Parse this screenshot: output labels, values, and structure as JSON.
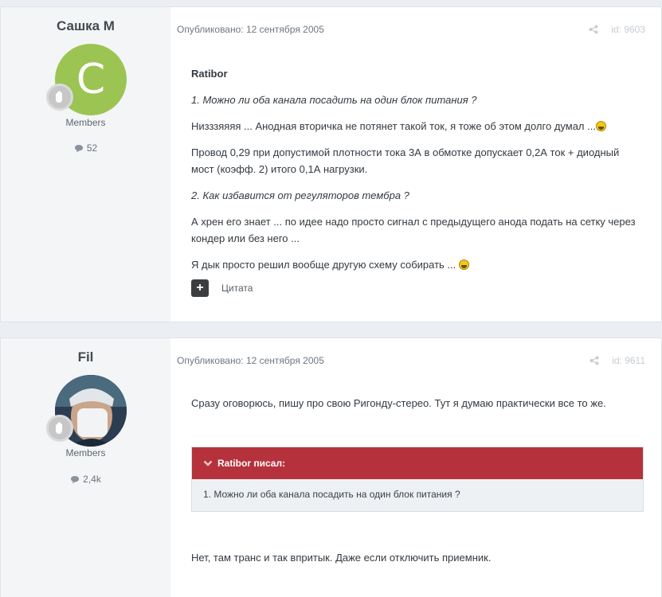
{
  "posts": [
    {
      "author": "Сашка М",
      "avatar_letter": "C",
      "group": "Members",
      "post_count": "52",
      "published": "Опубликовано: 12 сентября 2005",
      "post_id": "id: 9603",
      "paragraphs": [
        {
          "text": "Ratibor",
          "style": "strong"
        },
        {
          "text": "1. Можно ли оба канала посадить на один блок питания ?",
          "style": "ital"
        },
        {
          "text": "Низззяяяя ... Анодная вторичка не потянет такой ток, я тоже об этом долго думал ...",
          "style": "normal"
        },
        {
          "text": "Провод 0,29 при допустимой плотности тока 3А в обмотке допускает 0,2А ток + диодный мост (коэфф. 2) итого 0,1А нагрузки.",
          "style": "normal"
        },
        {
          "text": "2. Как избавится от регуляторов тембра ?",
          "style": "ital"
        },
        {
          "text": "А хрен его знает ... по идее надо просто сигнал с предыдущего анода подать на сетку через кондер или без него ...",
          "style": "normal"
        },
        {
          "text": "Я дык просто решил вообще другую схему собирать ...",
          "style": "normal"
        }
      ],
      "quote_button": "Цитата"
    },
    {
      "author": "Fil",
      "group": "Members",
      "post_count": "2,4k",
      "published": "Опубликовано: 12 сентября 2005",
      "post_id": "id: 9611",
      "intro": "Сразу оговорюсь, пишу про свою Ригонду-стерео. Тут я думаю практически все то же.",
      "quote_author": "Ratibor писал:",
      "quote_text": "1. Можно ли оба канала посадить на один блок питания ?",
      "reply": "Нет, там транс и так впритык. Даже если отключить приемник."
    }
  ],
  "colors": {
    "quote_header": "#b5323c",
    "avatar_green": "#9cc452"
  }
}
